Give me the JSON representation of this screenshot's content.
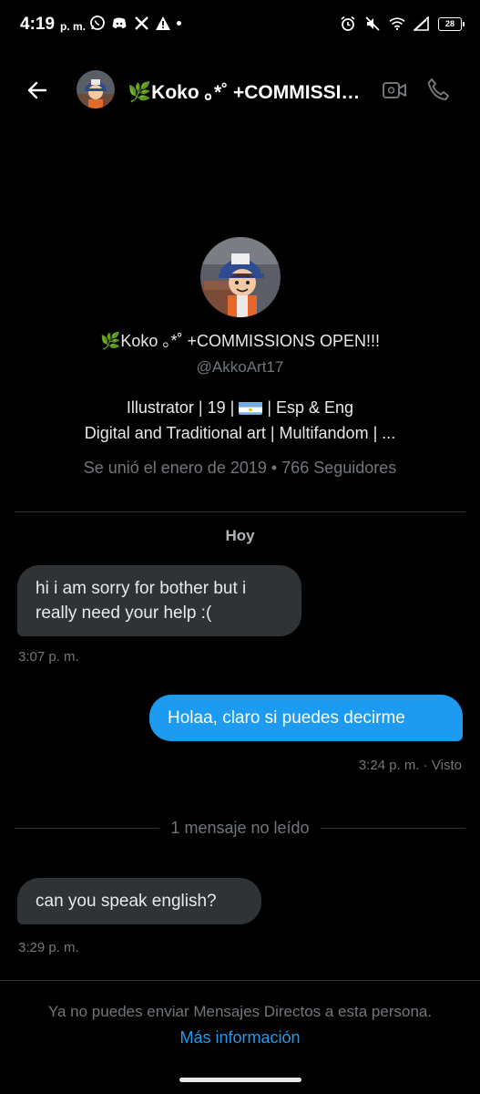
{
  "status_bar": {
    "time": "4:19",
    "ampm": "p. m.",
    "battery": "28",
    "left_icons": [
      "whatsapp-icon",
      "discord-icon",
      "x-icon",
      "warning-icon",
      "dot-icon"
    ],
    "right_icons": [
      "alarm-icon",
      "mute-icon",
      "wifi-icon",
      "signal-icon",
      "battery-icon"
    ]
  },
  "header": {
    "title": "🌿Koko ｡*˚ +COMMISSIONS OPEN!!!",
    "back_icon": "arrow-left-icon",
    "video_icon": "video-camera-icon",
    "call_icon": "phone-icon"
  },
  "profile": {
    "name": "🌿Koko ｡*˚ +COMMISSIONS OPEN!!!",
    "handle": "@AkkoArt17",
    "bio_line1_a": "Illustrator | 19 |",
    "bio_line1_b": "| Esp & Eng",
    "bio_line2": "Digital and Traditional art | Multifandom | ...",
    "joined": "Se unió el enero de 2019 • 766 Seguidores"
  },
  "conversation": {
    "day_label": "Hoy",
    "unread_label": "1 mensaje no leído",
    "messages": [
      {
        "text": "hi i am sorry for bother but i really need your help :(",
        "time": "3:07 p. m."
      },
      {
        "text": "Holaa, claro si puedes decirme",
        "time": "3:24 p. m. · Visto"
      },
      {
        "text": "can you speak english?",
        "time": "3:29 p. m."
      }
    ]
  },
  "footer": {
    "message": "Ya no puedes enviar Mensajes Directos a esta persona.",
    "link": "Más información"
  },
  "colors": {
    "background": "#000000",
    "accent": "#1d9bf0",
    "bubble_in": "#2f3336",
    "muted": "#71767b"
  }
}
